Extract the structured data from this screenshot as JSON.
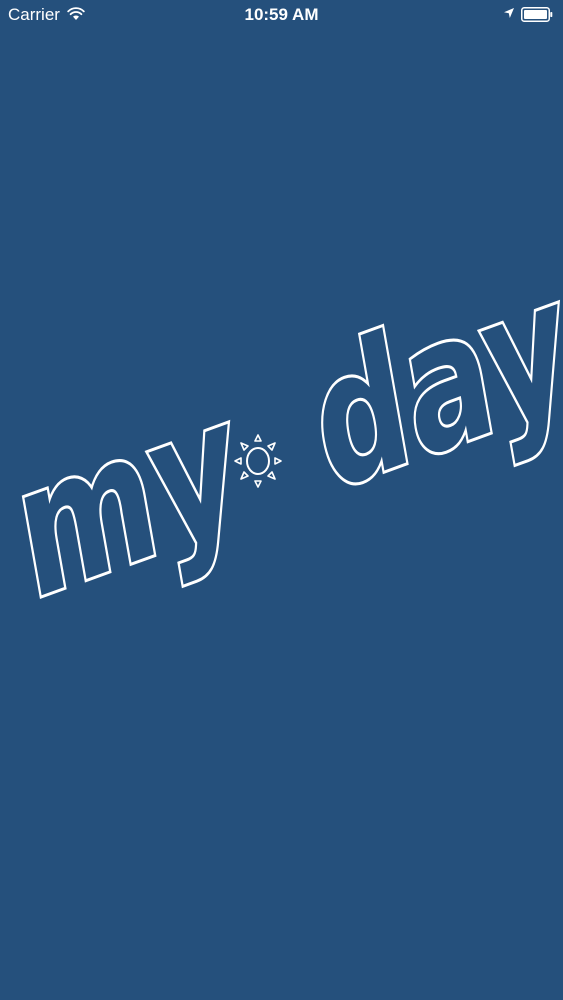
{
  "status_bar": {
    "carrier": "Carrier",
    "time": "10:59 AM",
    "wifi_icon": "wifi-icon",
    "location_icon": "location-arrow-icon",
    "battery_icon": "battery-icon"
  },
  "splash": {
    "logo_word_left": "my",
    "logo_word_right": "day",
    "logo_icon": "sun-icon",
    "background_color": "#25507c",
    "logo_color": "#ffffff"
  }
}
